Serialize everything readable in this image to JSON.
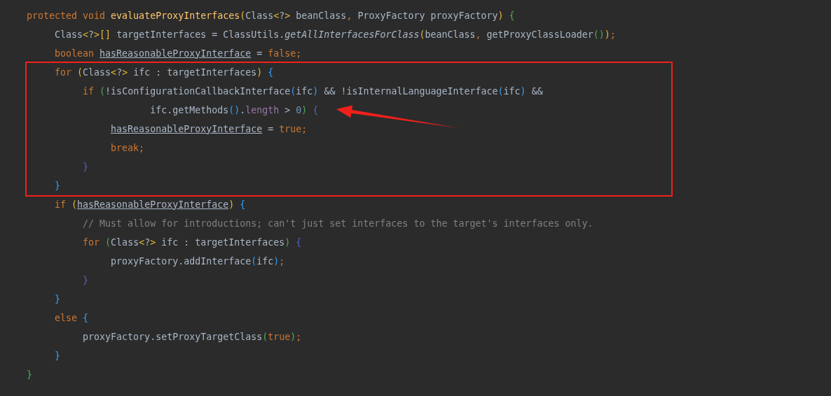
{
  "editor": {
    "lines": [
      {
        "highlighted": false,
        "arrow": false,
        "tokens": [
          {
            "text": "protected void ",
            "kind": "keyword"
          },
          {
            "text": "evaluateProxyInterfaces",
            "kind": "declaration"
          },
          {
            "text": "(",
            "kind": "yellow"
          },
          {
            "text": "Class",
            "kind": "plain"
          },
          {
            "text": "<",
            "kind": "yellow"
          },
          {
            "text": "?",
            "kind": "plain"
          },
          {
            "text": ">",
            "kind": "yellow"
          },
          {
            "text": " beanClass",
            "kind": "plain"
          },
          {
            "text": ",",
            "kind": "punct"
          },
          {
            "text": " ProxyFactory proxyFactory",
            "kind": "plain"
          },
          {
            "text": ")",
            "kind": "yellow"
          },
          {
            "text": " {",
            "kind": "green"
          }
        ]
      },
      {
        "highlighted": false,
        "arrow": false,
        "tokens": [
          {
            "text": "     Class",
            "kind": "plain"
          },
          {
            "text": "<",
            "kind": "yellow"
          },
          {
            "text": "?",
            "kind": "plain"
          },
          {
            "text": ">[]",
            "kind": "yellow"
          },
          {
            "text": " targetInterfaces = ClassUtils.",
            "kind": "plain"
          },
          {
            "text": "getAllInterfacesForClass",
            "kind": "static"
          },
          {
            "text": "(",
            "kind": "yellow"
          },
          {
            "text": "beanClass",
            "kind": "plain"
          },
          {
            "text": ",",
            "kind": "punct"
          },
          {
            "text": " getProxyClassLoader",
            "kind": "plain"
          },
          {
            "text": "()",
            "kind": "green"
          },
          {
            "text": ")",
            "kind": "yellow"
          },
          {
            "text": ";",
            "kind": "punct"
          }
        ]
      },
      {
        "highlighted": false,
        "arrow": false,
        "tokens": [
          {
            "text": "     boolean ",
            "kind": "keyword"
          },
          {
            "text": "hasReasonableProxyInterface",
            "kind": "variable"
          },
          {
            "text": " = ",
            "kind": "plain"
          },
          {
            "text": "false",
            "kind": "keyword"
          },
          {
            "text": ";",
            "kind": "punct"
          }
        ]
      },
      {
        "highlighted": true,
        "arrow": false,
        "tokens": [
          {
            "text": "     for ",
            "kind": "keyword"
          },
          {
            "text": "(",
            "kind": "yellow"
          },
          {
            "text": "Class",
            "kind": "plain"
          },
          {
            "text": "<",
            "kind": "yellow"
          },
          {
            "text": "?",
            "kind": "plain"
          },
          {
            "text": ">",
            "kind": "yellow"
          },
          {
            "text": " ifc : targetInterfaces",
            "kind": "plain"
          },
          {
            "text": ")",
            "kind": "yellow"
          },
          {
            "text": " {",
            "kind": "blue"
          }
        ]
      },
      {
        "highlighted": true,
        "arrow": false,
        "tokens": [
          {
            "text": "          if ",
            "kind": "keyword"
          },
          {
            "text": "(",
            "kind": "green"
          },
          {
            "text": "!isConfigurationCallbackInterface",
            "kind": "plain"
          },
          {
            "text": "(",
            "kind": "blue"
          },
          {
            "text": "ifc",
            "kind": "plain"
          },
          {
            "text": ")",
            "kind": "blue"
          },
          {
            "text": " && !isInternalLanguageInterface",
            "kind": "plain"
          },
          {
            "text": "(",
            "kind": "blue"
          },
          {
            "text": "ifc",
            "kind": "plain"
          },
          {
            "text": ")",
            "kind": "blue"
          },
          {
            "text": " &&",
            "kind": "plain"
          }
        ]
      },
      {
        "highlighted": true,
        "arrow": true,
        "tokens": [
          {
            "text": "                      ifc.getMethods",
            "kind": "plain"
          },
          {
            "text": "()",
            "kind": "blue"
          },
          {
            "text": ".",
            "kind": "plain"
          },
          {
            "text": "length",
            "kind": "field"
          },
          {
            "text": " > ",
            "kind": "plain"
          },
          {
            "text": "0",
            "kind": "number"
          },
          {
            "text": ")",
            "kind": "green"
          },
          {
            "text": " {",
            "kind": "navy"
          }
        ]
      },
      {
        "highlighted": true,
        "arrow": false,
        "tokens": [
          {
            "text": "               hasReasonableProxyInterface",
            "kind": "variable"
          },
          {
            "text": " = ",
            "kind": "plain"
          },
          {
            "text": "true",
            "kind": "keyword"
          },
          {
            "text": ";",
            "kind": "punct"
          }
        ]
      },
      {
        "highlighted": true,
        "arrow": false,
        "tokens": [
          {
            "text": "               break;",
            "kind": "keyword"
          }
        ]
      },
      {
        "highlighted": true,
        "arrow": false,
        "tokens": [
          {
            "text": "          }",
            "kind": "navy"
          }
        ]
      },
      {
        "highlighted": true,
        "arrow": false,
        "tokens": [
          {
            "text": "     }",
            "kind": "blue"
          }
        ]
      },
      {
        "highlighted": false,
        "arrow": false,
        "tokens": [
          {
            "text": "     if ",
            "kind": "keyword"
          },
          {
            "text": "(",
            "kind": "yellow"
          },
          {
            "text": "hasReasonableProxyInterface",
            "kind": "variable"
          },
          {
            "text": ")",
            "kind": "yellow"
          },
          {
            "text": " {",
            "kind": "blue"
          }
        ]
      },
      {
        "highlighted": false,
        "arrow": false,
        "tokens": [
          {
            "text": "          // Must allow for introductions; can't just set interfaces to the target's interfaces only.",
            "kind": "comment"
          }
        ]
      },
      {
        "highlighted": false,
        "arrow": false,
        "tokens": [
          {
            "text": "          for ",
            "kind": "keyword"
          },
          {
            "text": "(",
            "kind": "green"
          },
          {
            "text": "Class",
            "kind": "plain"
          },
          {
            "text": "<",
            "kind": "yellow"
          },
          {
            "text": "?",
            "kind": "plain"
          },
          {
            "text": ">",
            "kind": "yellow"
          },
          {
            "text": " ifc : targetInterfaces",
            "kind": "plain"
          },
          {
            "text": ")",
            "kind": "green"
          },
          {
            "text": " {",
            "kind": "navy"
          }
        ]
      },
      {
        "highlighted": false,
        "arrow": false,
        "tokens": [
          {
            "text": "               proxyFactory.addInterface",
            "kind": "plain"
          },
          {
            "text": "(",
            "kind": "blue"
          },
          {
            "text": "ifc",
            "kind": "plain"
          },
          {
            "text": ")",
            "kind": "blue"
          },
          {
            "text": ";",
            "kind": "punct"
          }
        ]
      },
      {
        "highlighted": false,
        "arrow": false,
        "tokens": [
          {
            "text": "          }",
            "kind": "navy"
          }
        ]
      },
      {
        "highlighted": false,
        "arrow": false,
        "tokens": [
          {
            "text": "     }",
            "kind": "blue"
          }
        ]
      },
      {
        "highlighted": false,
        "arrow": false,
        "tokens": [
          {
            "text": "     else ",
            "kind": "keyword"
          },
          {
            "text": "{",
            "kind": "blue"
          }
        ]
      },
      {
        "highlighted": false,
        "arrow": false,
        "tokens": [
          {
            "text": "          proxyFactory.setProxyTargetClass",
            "kind": "plain"
          },
          {
            "text": "(",
            "kind": "green"
          },
          {
            "text": "true",
            "kind": "keyword"
          },
          {
            "text": ")",
            "kind": "green"
          },
          {
            "text": ";",
            "kind": "punct"
          }
        ]
      },
      {
        "highlighted": false,
        "arrow": false,
        "tokens": [
          {
            "text": "     }",
            "kind": "blue"
          }
        ]
      },
      {
        "highlighted": false,
        "arrow": false,
        "tokens": [
          {
            "text": "}",
            "kind": "green"
          }
        ]
      }
    ]
  }
}
